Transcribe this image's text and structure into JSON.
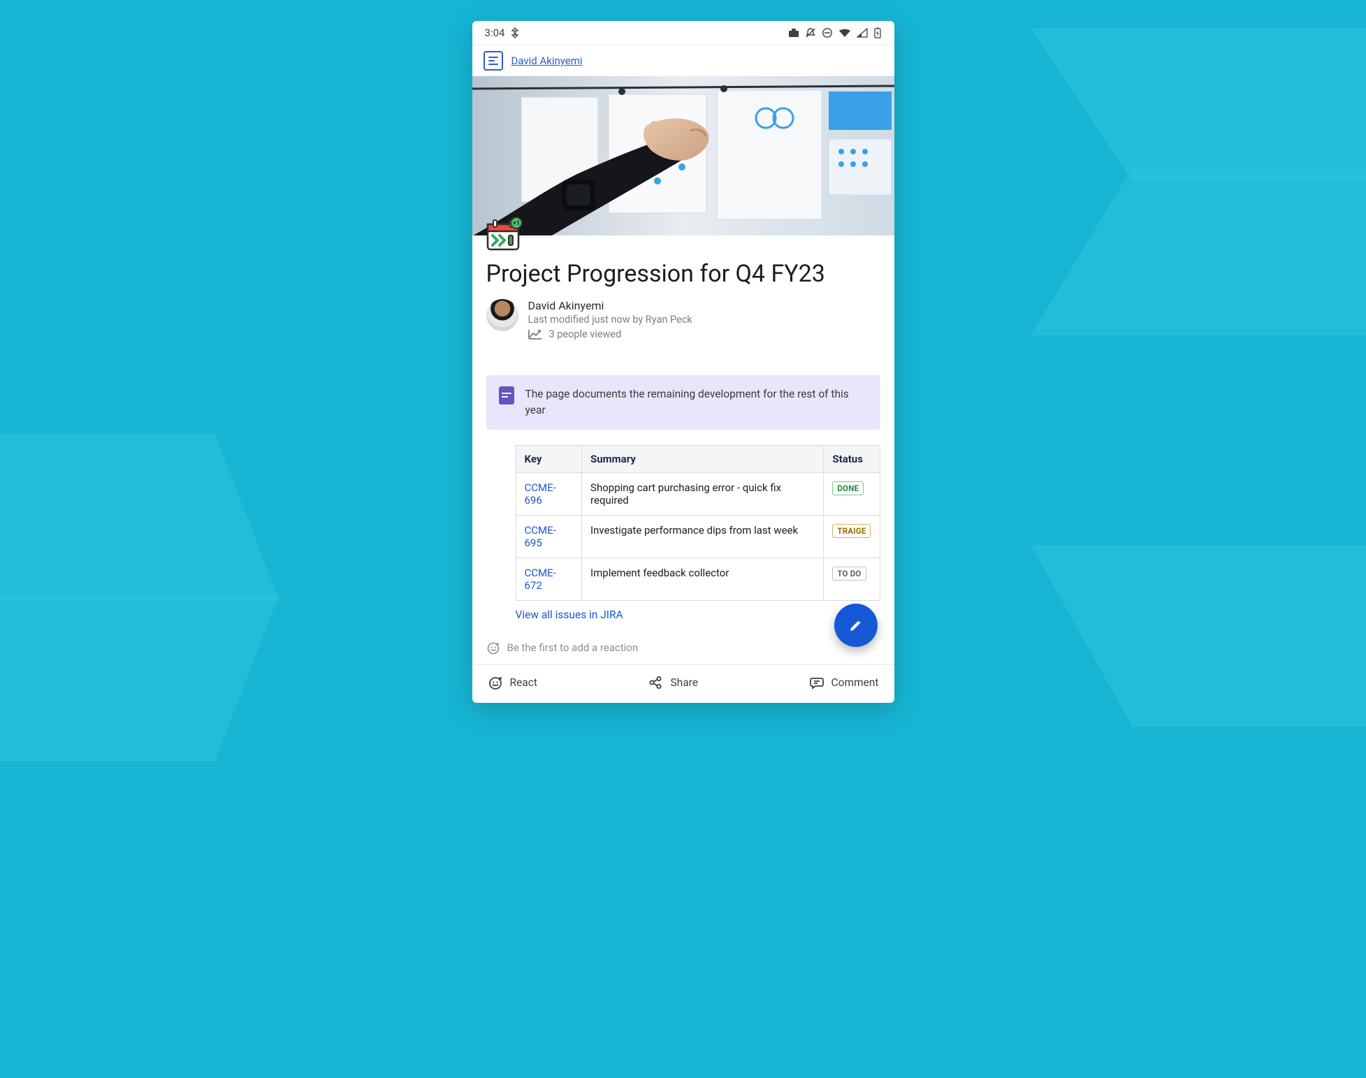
{
  "status_bar": {
    "time": "3:04"
  },
  "breadcrumb": {
    "author_link": "David Akinyemi"
  },
  "page": {
    "title": "Project Progression for Q4 FY23",
    "author": "David Akinyemi",
    "modified_line": "Last modified just now by Ryan Peck",
    "viewed_line": "3 people viewed"
  },
  "panel": {
    "text": "The page documents the remaining development for the rest of this year"
  },
  "table": {
    "headers": {
      "key": "Key",
      "summary": "Summary",
      "status": "Status"
    },
    "rows": [
      {
        "key": "CCME-696",
        "summary": "Shopping cart purchasing error - quick fix required",
        "status": "DONE",
        "status_color": "#1f8b3b",
        "status_border": "#78c78d",
        "status_bg": "#ffffff"
      },
      {
        "key": "CCME-695",
        "summary": "Investigate performance dips from last week",
        "status": "TRAIGE",
        "status_color": "#9a6b00",
        "status_border": "#d7b36a",
        "status_bg": "#ffffff"
      },
      {
        "key": "CCME-672",
        "summary": "Implement feedback collector",
        "status": "TO DO",
        "status_color": "#5a6470",
        "status_border": "#b9c0c8",
        "status_bg": "#ffffff"
      }
    ],
    "view_all": "View all issues in JIRA"
  },
  "reactions": {
    "prompt": "Be the first to add a reaction"
  },
  "bottom_bar": {
    "react": "React",
    "share": "Share",
    "comment": "Comment"
  }
}
